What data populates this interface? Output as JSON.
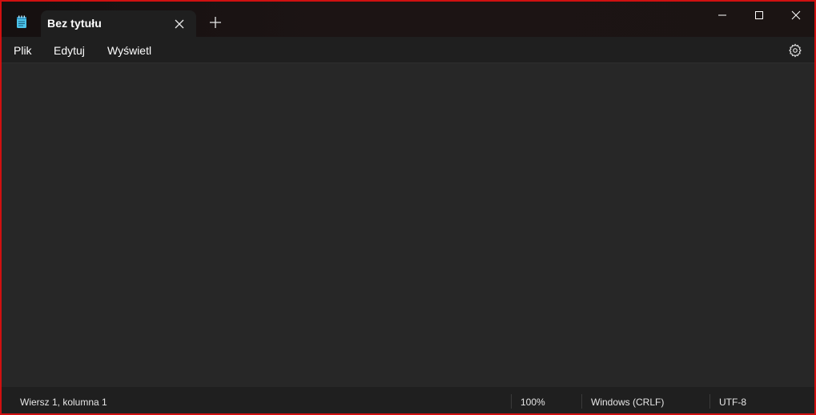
{
  "window": {
    "accent_border": "#d01010",
    "minimize_icon": "minimize-icon",
    "maximize_icon": "maximize-icon",
    "close_icon": "close-icon"
  },
  "app": {
    "icon": "notepad-icon"
  },
  "tabs": [
    {
      "title": "Bez tytułu",
      "active": true,
      "close_icon": "close-icon"
    }
  ],
  "new_tab_icon": "plus-icon",
  "menu": {
    "items": [
      "Plik",
      "Edytuj",
      "Wyświetl"
    ],
    "settings_icon": "gear-icon"
  },
  "editor": {
    "content": ""
  },
  "statusbar": {
    "position": "Wiersz 1, kolumna 1",
    "zoom": "100%",
    "line_endings": "Windows (CRLF)",
    "encoding": "UTF-8"
  }
}
